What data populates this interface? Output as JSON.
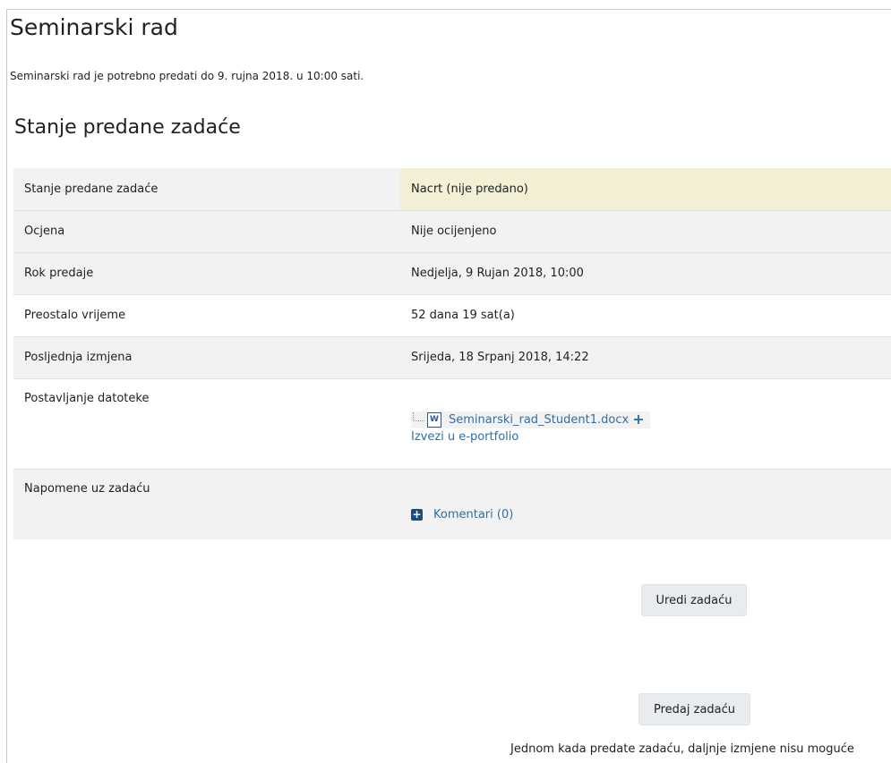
{
  "page": {
    "title": "Seminarski rad",
    "intro": "Seminarski rad je potrebno predati do 9. rujna 2018. u 10:00 sati.",
    "section_title": "Stanje predane zadaće"
  },
  "status_table": {
    "rows": [
      {
        "label": "Stanje predane zadaće",
        "value": "Nacrt (nije predano)"
      },
      {
        "label": "Ocjena",
        "value": "Nije ocijenjeno"
      },
      {
        "label": "Rok predaje",
        "value": "Nedjelja, 9 Rujan 2018, 10:00"
      },
      {
        "label": "Preostalo vrijeme",
        "value": "52 dana 19 sat(a)"
      },
      {
        "label": "Posljednja izmjena",
        "value": "Srijeda, 18 Srpanj 2018, 14:22"
      },
      {
        "label": "Postavljanje datoteke"
      },
      {
        "label": "Napomene uz zadaću"
      }
    ],
    "file": {
      "icon": "word-doc-icon",
      "name": "Seminarski_rad_Student1.docx",
      "add_icon": "plus-icon",
      "portfolio_link": "Izvezi u e-portfolio"
    },
    "comments": {
      "icon": "expand-plus-icon",
      "label": "Komentari (0)"
    }
  },
  "actions": {
    "edit_label": "Uredi zadaću",
    "submit_label": "Predaj zadaću",
    "note": "Jednom kada predate zadaću, daljnje izmjene nisu moguće"
  },
  "colors": {
    "draft_highlight": "#f3f0d6",
    "link": "#2f6fa7",
    "row_shade": "#f2f2f2"
  }
}
